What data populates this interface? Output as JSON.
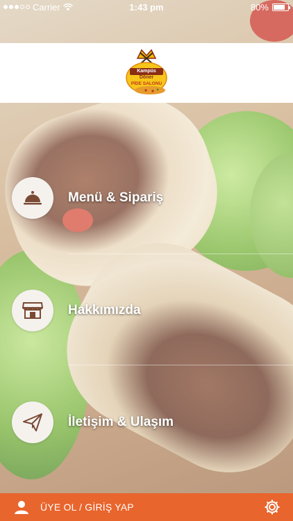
{
  "status_bar": {
    "carrier": "Carrier",
    "time": "1:43 pm",
    "battery": "80%",
    "battery_level": 0.8
  },
  "header": {
    "logo_line1": "Kampüs",
    "logo_line2": "Döner",
    "logo_line3": "PİDE SALONU"
  },
  "menu": {
    "items": [
      {
        "label": "Menü & Sipariş",
        "icon": "cloche-icon"
      },
      {
        "label": "Hakkımızda",
        "icon": "store-icon"
      },
      {
        "label": "İletişim & Ulaşım",
        "icon": "paper-plane-icon"
      }
    ]
  },
  "bottom_bar": {
    "login_label": "ÜYE OL / GİRİŞ YAP",
    "user_icon": "user-icon",
    "settings_icon": "gear-icon"
  },
  "colors": {
    "accent": "#e8652d",
    "circle_bg": "#f5f2ee",
    "icon_color": "#7a4a35"
  }
}
